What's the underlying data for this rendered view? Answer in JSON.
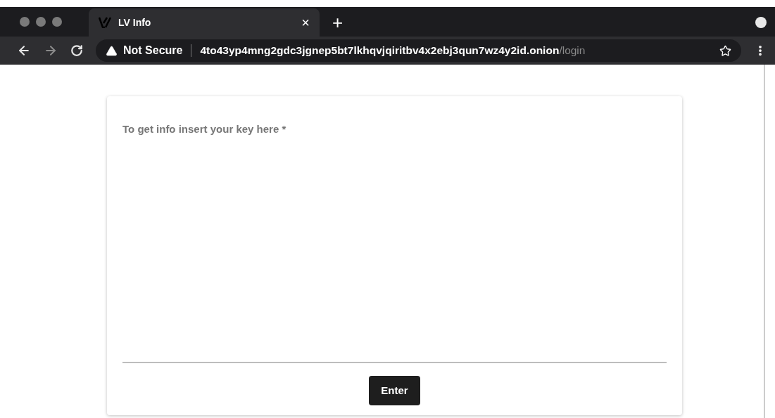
{
  "tab": {
    "title": "LV Info",
    "close": "×",
    "new_tab": "+"
  },
  "toolbar": {
    "security": "Not Secure",
    "address": {
      "host": "4to43yp4mng2gdc3jgnep5bt7lkhqvjqiritbv4x2ebj3qun7wz4y2id.onion",
      "path": "/login"
    }
  },
  "form": {
    "field_label": "To get info insert your key here *",
    "button": "Enter"
  }
}
